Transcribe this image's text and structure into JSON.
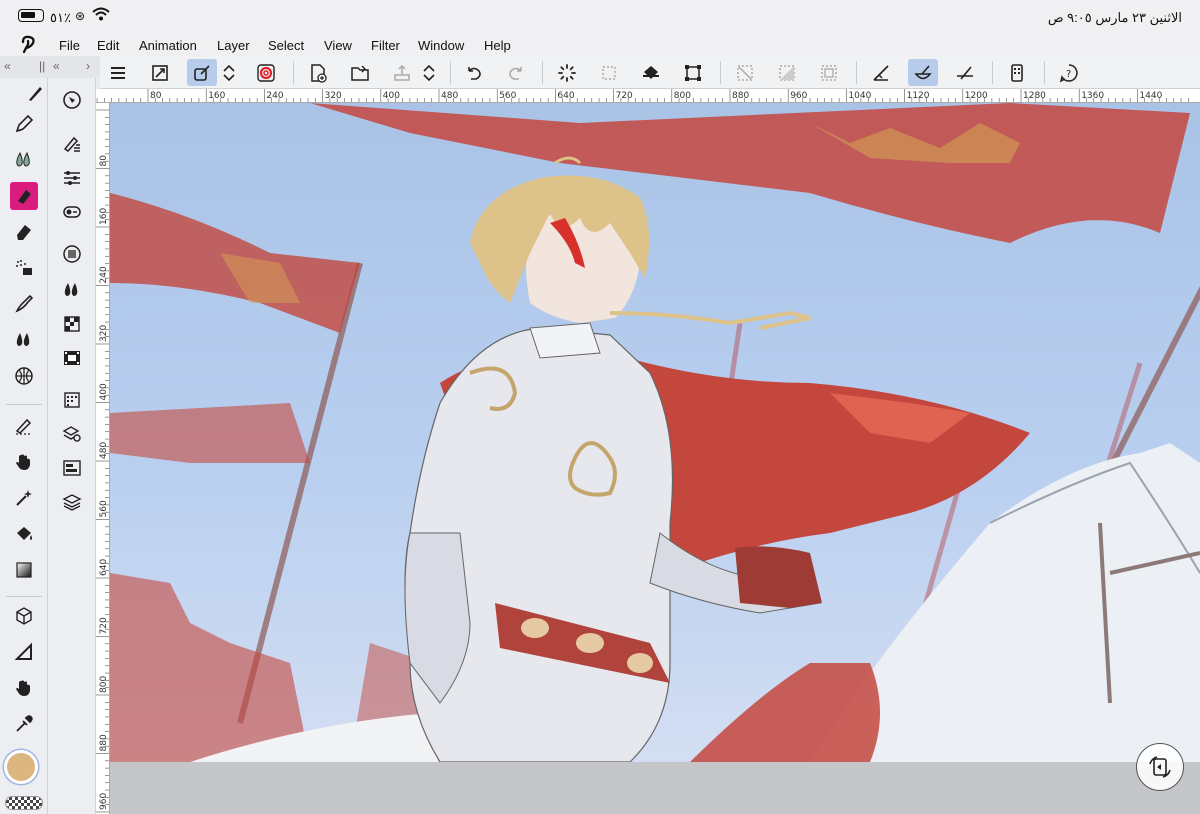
{
  "status": {
    "battery_pct": "٥١٪",
    "datetime": "الاثنين ٢٣ مارس    ٩:٠٥ ص"
  },
  "menu": {
    "items": [
      "File",
      "Edit",
      "Animation",
      "Layer",
      "Select",
      "View",
      "Filter",
      "Window",
      "Help"
    ]
  },
  "toolbar": {
    "icons": [
      "menu-icon",
      "canvas-expand-icon",
      "transform-icon",
      "stepper-icon",
      "realtime-icon",
      "new-canvas-icon",
      "open-folder-icon",
      "export-icon",
      "stepper-icon",
      "undo-icon",
      "redo-icon",
      "loading-icon",
      "deselect-icon",
      "fill-icon",
      "crop-icon",
      "clear-selection-icon",
      "gradient-selection-icon",
      "layer-box-icon",
      "ruler-snap-icon",
      "brush-stroke-icon",
      "straight-ruler-icon",
      "device-icon",
      "help-icon"
    ]
  },
  "left_header": {
    "collapse_left": "«",
    "grip": "||",
    "collapse_right": "«",
    "expand": "›"
  },
  "tools_col1": [
    "brush-icon",
    "pen-icon",
    "watercolor-icon",
    "marker-icon",
    "eraser-icon",
    "airbrush-icon",
    "blend-icon",
    "drops-icon",
    "perspective-icon",
    "correct-line-icon",
    "hand-icon",
    "magic-wand-icon",
    "bucket-icon",
    "gradient-icon",
    "object-icon",
    "figure-icon",
    "hand-pan-icon",
    "eyedropper-icon"
  ],
  "tools_col2": [
    "navigator-icon",
    "sub-tool-icon",
    "tool-property-icon",
    "brush-size-icon",
    "color-circle-icon",
    "color-set-icon",
    "material-icon",
    "timeline-icon",
    "layer-property-icon",
    "search-layer-icon",
    "layer-panel-icon",
    "layers-icon"
  ],
  "ruler": {
    "h_ticks": [
      "80",
      "160",
      "240",
      "320",
      "400",
      "480",
      "560",
      "640",
      "720",
      "800",
      "880",
      "960",
      "1040",
      "1120",
      "1200",
      "1280",
      "1360",
      "1440"
    ],
    "v_ticks": [
      "80",
      "160",
      "240",
      "320",
      "400",
      "480",
      "560",
      "640",
      "720",
      "800",
      "880",
      "960"
    ]
  },
  "colors": {
    "accent": "#b7ccea",
    "active_tool": "#d91c7e",
    "main_color": "#dcb680",
    "banner_red": "#c4473e",
    "sky": "#b0c8ea"
  }
}
